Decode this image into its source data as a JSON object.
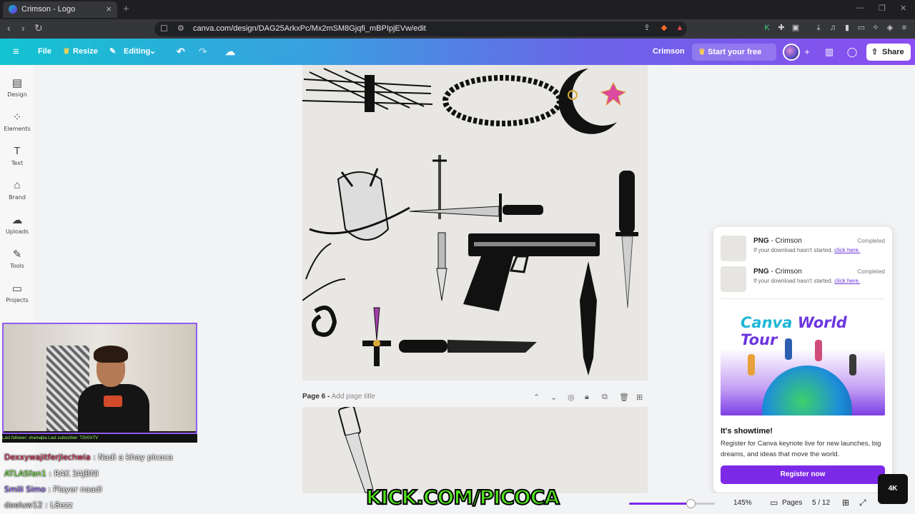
{
  "browser": {
    "tab_title": "Crimson - Logo",
    "tab_close": "×",
    "new_tab": "+",
    "url": "canva.com/design/DAG25ArkxPc/Mx2mSM8Gjqfi_mBPIpjEVw/edit"
  },
  "header": {
    "file": "File",
    "resize": "Resize",
    "editing": "Editing",
    "doc_title": "Crimson",
    "trial": "Start your free trial",
    "share": "Share"
  },
  "rail": {
    "items": [
      {
        "label": "Design",
        "icon": "design-icon"
      },
      {
        "label": "Elements",
        "icon": "elements-icon"
      },
      {
        "label": "Text",
        "icon": "text-icon"
      },
      {
        "label": "Brand",
        "icon": "brand-icon"
      },
      {
        "label": "Uploads",
        "icon": "uploads-icon"
      },
      {
        "label": "Tools",
        "icon": "tools-icon"
      },
      {
        "label": "Projects",
        "icon": "projects-icon"
      }
    ]
  },
  "page6": {
    "label": "Page 6 -",
    "placeholder": "Add page title"
  },
  "downloads": [
    {
      "type": "PNG",
      "name": "- Crimson",
      "status": "Completed",
      "hint": "If your download hasn't started,",
      "link": "click here."
    },
    {
      "type": "PNG",
      "name": "- Crimson",
      "status": "Completed",
      "hint": "If your download hasn't started,",
      "link": "click here."
    }
  ],
  "promo": {
    "title_a": "Canva",
    "title_b": "World Tour",
    "heading": "It's showtime!",
    "body": "Register for Canva keynote live for new launches, big dreams, and ideas that move the world.",
    "button": "Register now"
  },
  "bottom": {
    "zoom": "145%",
    "zoom_level": 0.72,
    "pages_label": "Pages",
    "page_count": "5 / 12"
  },
  "stream": {
    "strip": "Last follower: shamajka   Last subscriber: T3V0XTV",
    "chat": [
      {
        "user": "Dexxywajitferjlechwia",
        "msg": ": Nadi a khay picoca"
      },
      {
        "user": "ATLASfan1",
        "msg": ": RAK 3AJBNI"
      },
      {
        "user": "Smili Simo",
        "msg": ": Player naadi"
      },
      {
        "user": "doeluw12",
        "msg": ": L8ezz"
      }
    ],
    "overlay": "KICK.COM/PICOCA",
    "badge": "4K"
  },
  "colors": {
    "accent": "#7d2ae8",
    "header_start": "#13c3d1",
    "header_end": "#8a4ef0"
  }
}
